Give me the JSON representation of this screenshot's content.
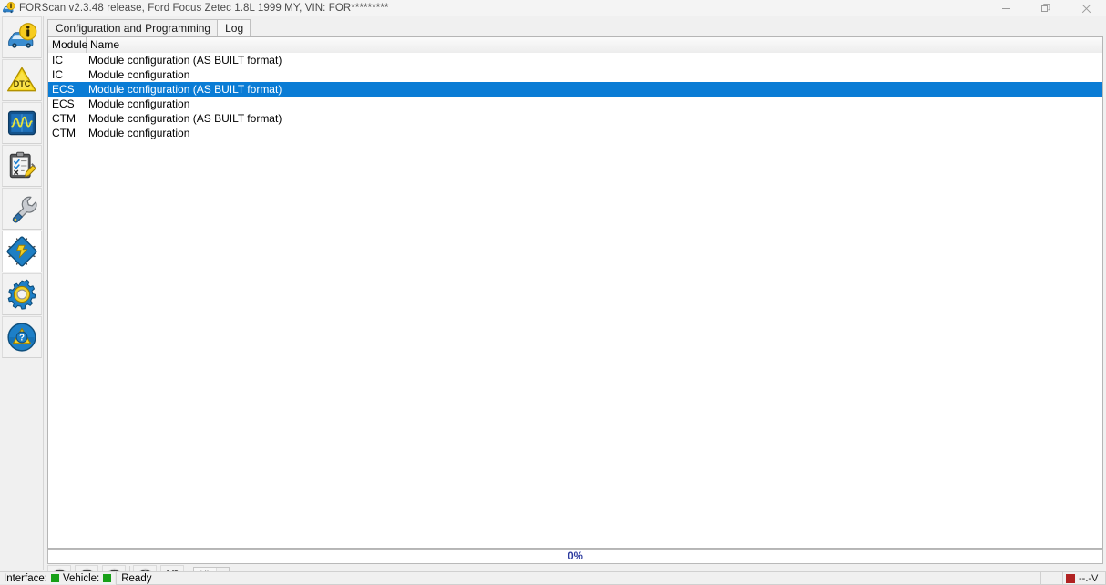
{
  "window": {
    "title": "FORScan v2.3.48 release, Ford Focus Zetec 1.8L 1999 MY, VIN: FOR*********",
    "app_icon": "car-info-icon",
    "controls": {
      "minimize": "minimize-icon",
      "restore": "restore-icon",
      "close": "close-icon"
    }
  },
  "sidebar": {
    "items": [
      {
        "id": "vehicle-info",
        "icon": "car-info-icon",
        "active": false
      },
      {
        "id": "dtc",
        "icon": "dtc-warning-icon",
        "active": false
      },
      {
        "id": "oscilloscope",
        "icon": "oscilloscope-icon",
        "active": false
      },
      {
        "id": "tests",
        "icon": "checklist-edit-icon",
        "active": false
      },
      {
        "id": "service",
        "icon": "wrench-icon",
        "active": false
      },
      {
        "id": "configuration",
        "icon": "chip-icon",
        "active": true
      },
      {
        "id": "settings",
        "icon": "gear-icon",
        "active": false
      },
      {
        "id": "help",
        "icon": "steering-help-icon",
        "active": false
      }
    ]
  },
  "tabs": [
    {
      "label": "Configuration and Programming",
      "active": true
    },
    {
      "label": "Log",
      "active": false
    }
  ],
  "table": {
    "columns": [
      "Module",
      "Name"
    ],
    "rows": [
      {
        "module": "IC",
        "name": "Module configuration (AS BUILT format)",
        "selected": false
      },
      {
        "module": "IC",
        "name": "Module configuration",
        "selected": false
      },
      {
        "module": "ECS",
        "name": "Module configuration (AS BUILT format)",
        "selected": true
      },
      {
        "module": "ECS",
        "name": "Module configuration",
        "selected": false
      },
      {
        "module": "CTM",
        "name": "Module configuration (AS BUILT format)",
        "selected": false
      },
      {
        "module": "CTM",
        "name": "Module configuration",
        "selected": false
      }
    ],
    "selection_color": "#0a7cd5"
  },
  "progress": {
    "label": "0%",
    "value": 0,
    "text_color": "#2b3a9e"
  },
  "toolbar": {
    "buttons": [
      {
        "id": "run",
        "icon": "play-icon"
      },
      {
        "id": "stop",
        "icon": "stop-icon"
      },
      {
        "id": "cancel",
        "icon": "cross-circle-icon"
      },
      {
        "id": "clear",
        "icon": "trash-circle-icon"
      },
      {
        "id": "save",
        "icon": "floppy-save-icon"
      }
    ],
    "filter": {
      "value": "All",
      "icon": "chevron-down-icon"
    }
  },
  "statusbar": {
    "interface_label": "Interface:",
    "interface_state_color": "#18a018",
    "vehicle_label": "Vehicle:",
    "vehicle_state_color": "#18a018",
    "status_text": "Ready",
    "voltage_text": "--.-V",
    "voltage_state_color": "#b12222"
  }
}
